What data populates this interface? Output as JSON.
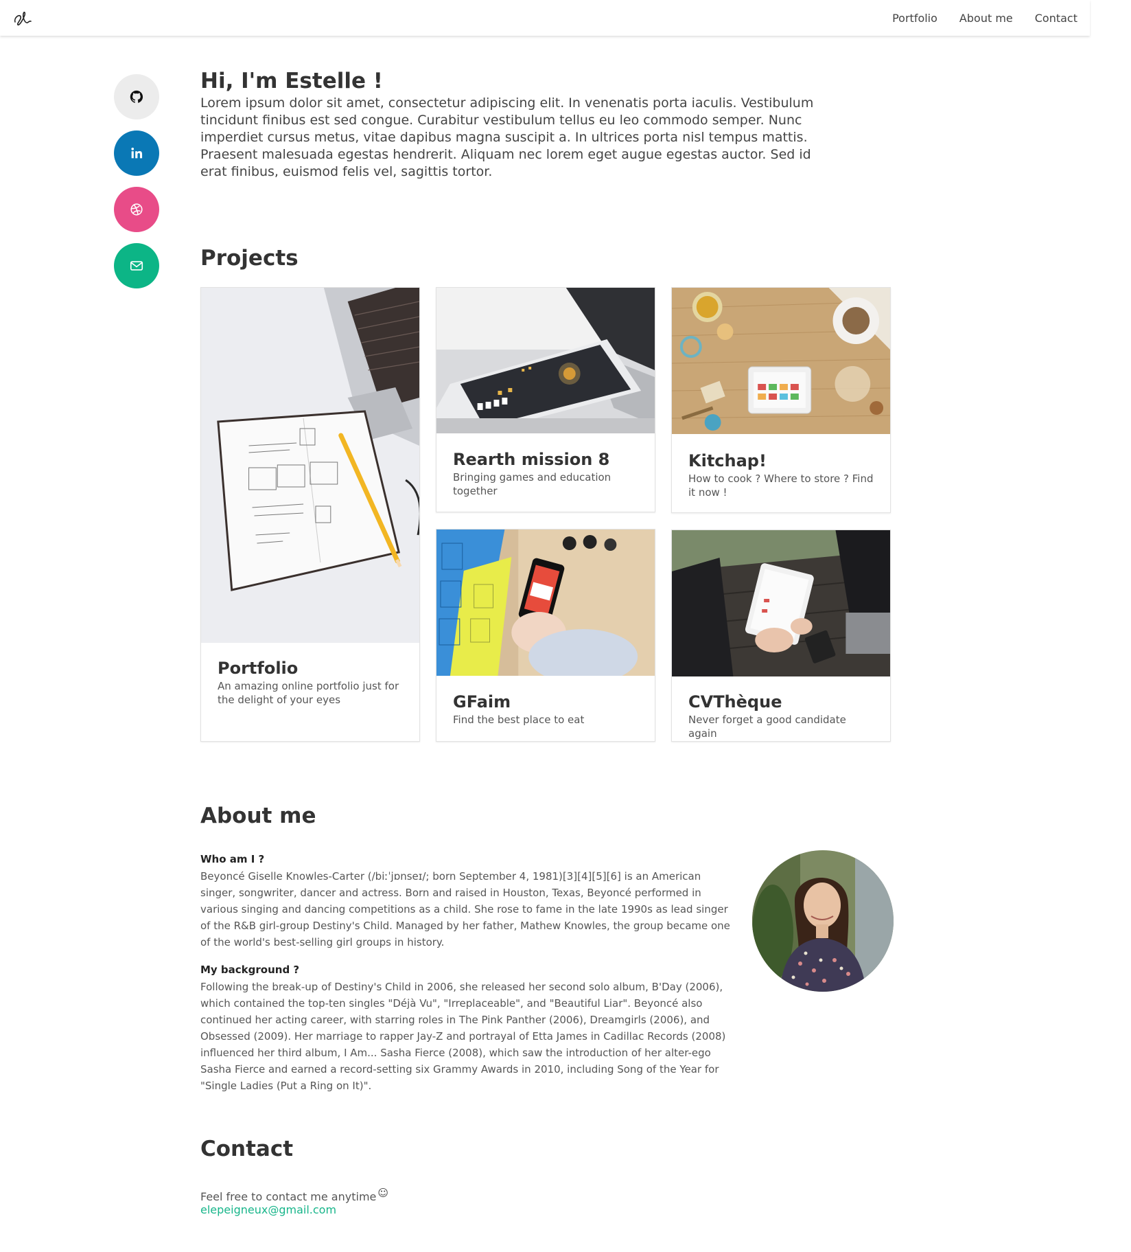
{
  "nav": {
    "brand_icon": "signature-logo-icon",
    "links": [
      {
        "label": "Portfolio"
      },
      {
        "label": "About me"
      },
      {
        "label": "Contact"
      }
    ]
  },
  "social": [
    {
      "name": "github",
      "icon": "github-icon",
      "color": "#ececec"
    },
    {
      "name": "linkedin",
      "icon": "linkedin-icon",
      "color": "#0a78b5"
    },
    {
      "name": "dribbble",
      "icon": "dribbble-icon",
      "color": "#e84c88"
    },
    {
      "name": "email",
      "icon": "envelope-icon",
      "color": "#0cb586"
    }
  ],
  "hero": {
    "title": "Hi, I'm Estelle !",
    "text": "Lorem ipsum dolor sit amet, consectetur adipiscing elit. In venenatis porta iaculis. Vestibulum tincidunt finibus est sed congue. Curabitur vestibulum tellus eu leo commodo semper. Nunc imperdiet cursus metus, vitae dapibus magna suscipit a. In ultrices porta nisl tempus mattis. Praesent malesuada egestas hendrerit. Aliquam nec lorem eget augue egestas auctor. Sed id erat finibus, euismod felis vel, sagittis tortor."
  },
  "projects": {
    "title": "Projects",
    "items": [
      {
        "title": "Portfolio",
        "description": "An amazing online portfolio just for the delight of your eyes"
      },
      {
        "title": "Rearth mission 8",
        "description": "Bringing games and education together"
      },
      {
        "title": "Kitchap!",
        "description": "How to cook ? Where to store ? Find it now !"
      },
      {
        "title": "GFaim",
        "description": "Find the best place to eat"
      },
      {
        "title": "CVThèque",
        "description": "Never forget a good candidate again"
      }
    ]
  },
  "about": {
    "title": "About me",
    "who_heading": "Who am I ?",
    "who_text": "Beyoncé Giselle Knowles-Carter (/biːˈjɒnseɪ/; born September 4, 1981)[3][4][5][6] is an American singer, songwriter, dancer and actress. Born and raised in Houston, Texas, Beyoncé performed in various singing and dancing competitions as a child. She rose to fame in the late 1990s as lead singer of the R&B girl-group Destiny's Child. Managed by her father, Mathew Knowles, the group became one of the world's best-selling girl groups in history.",
    "background_heading": "My background ?",
    "background_text": "Following the break-up of Destiny's Child in 2006, she released her second solo album, B'Day (2006), which contained the top-ten singles \"Déjà Vu\", \"Irreplaceable\", and \"Beautiful Liar\". Beyoncé also continued her acting career, with starring roles in The Pink Panther (2006), Dreamgirls (2006), and Obsessed (2009). Her marriage to rapper Jay-Z and portrayal of Etta James in Cadillac Records (2008) influenced her third album, I Am... Sasha Fierce (2008), which saw the introduction of her alter-ego Sasha Fierce and earned a record-setting six Grammy Awards in 2010, including Song of the Year for \"Single Ladies (Put a Ring on It)\"."
  },
  "contact": {
    "title": "Contact",
    "text": "Feel free to contact me anytime",
    "smiley": "☺",
    "email": "elepeigneux@gmail.com"
  }
}
